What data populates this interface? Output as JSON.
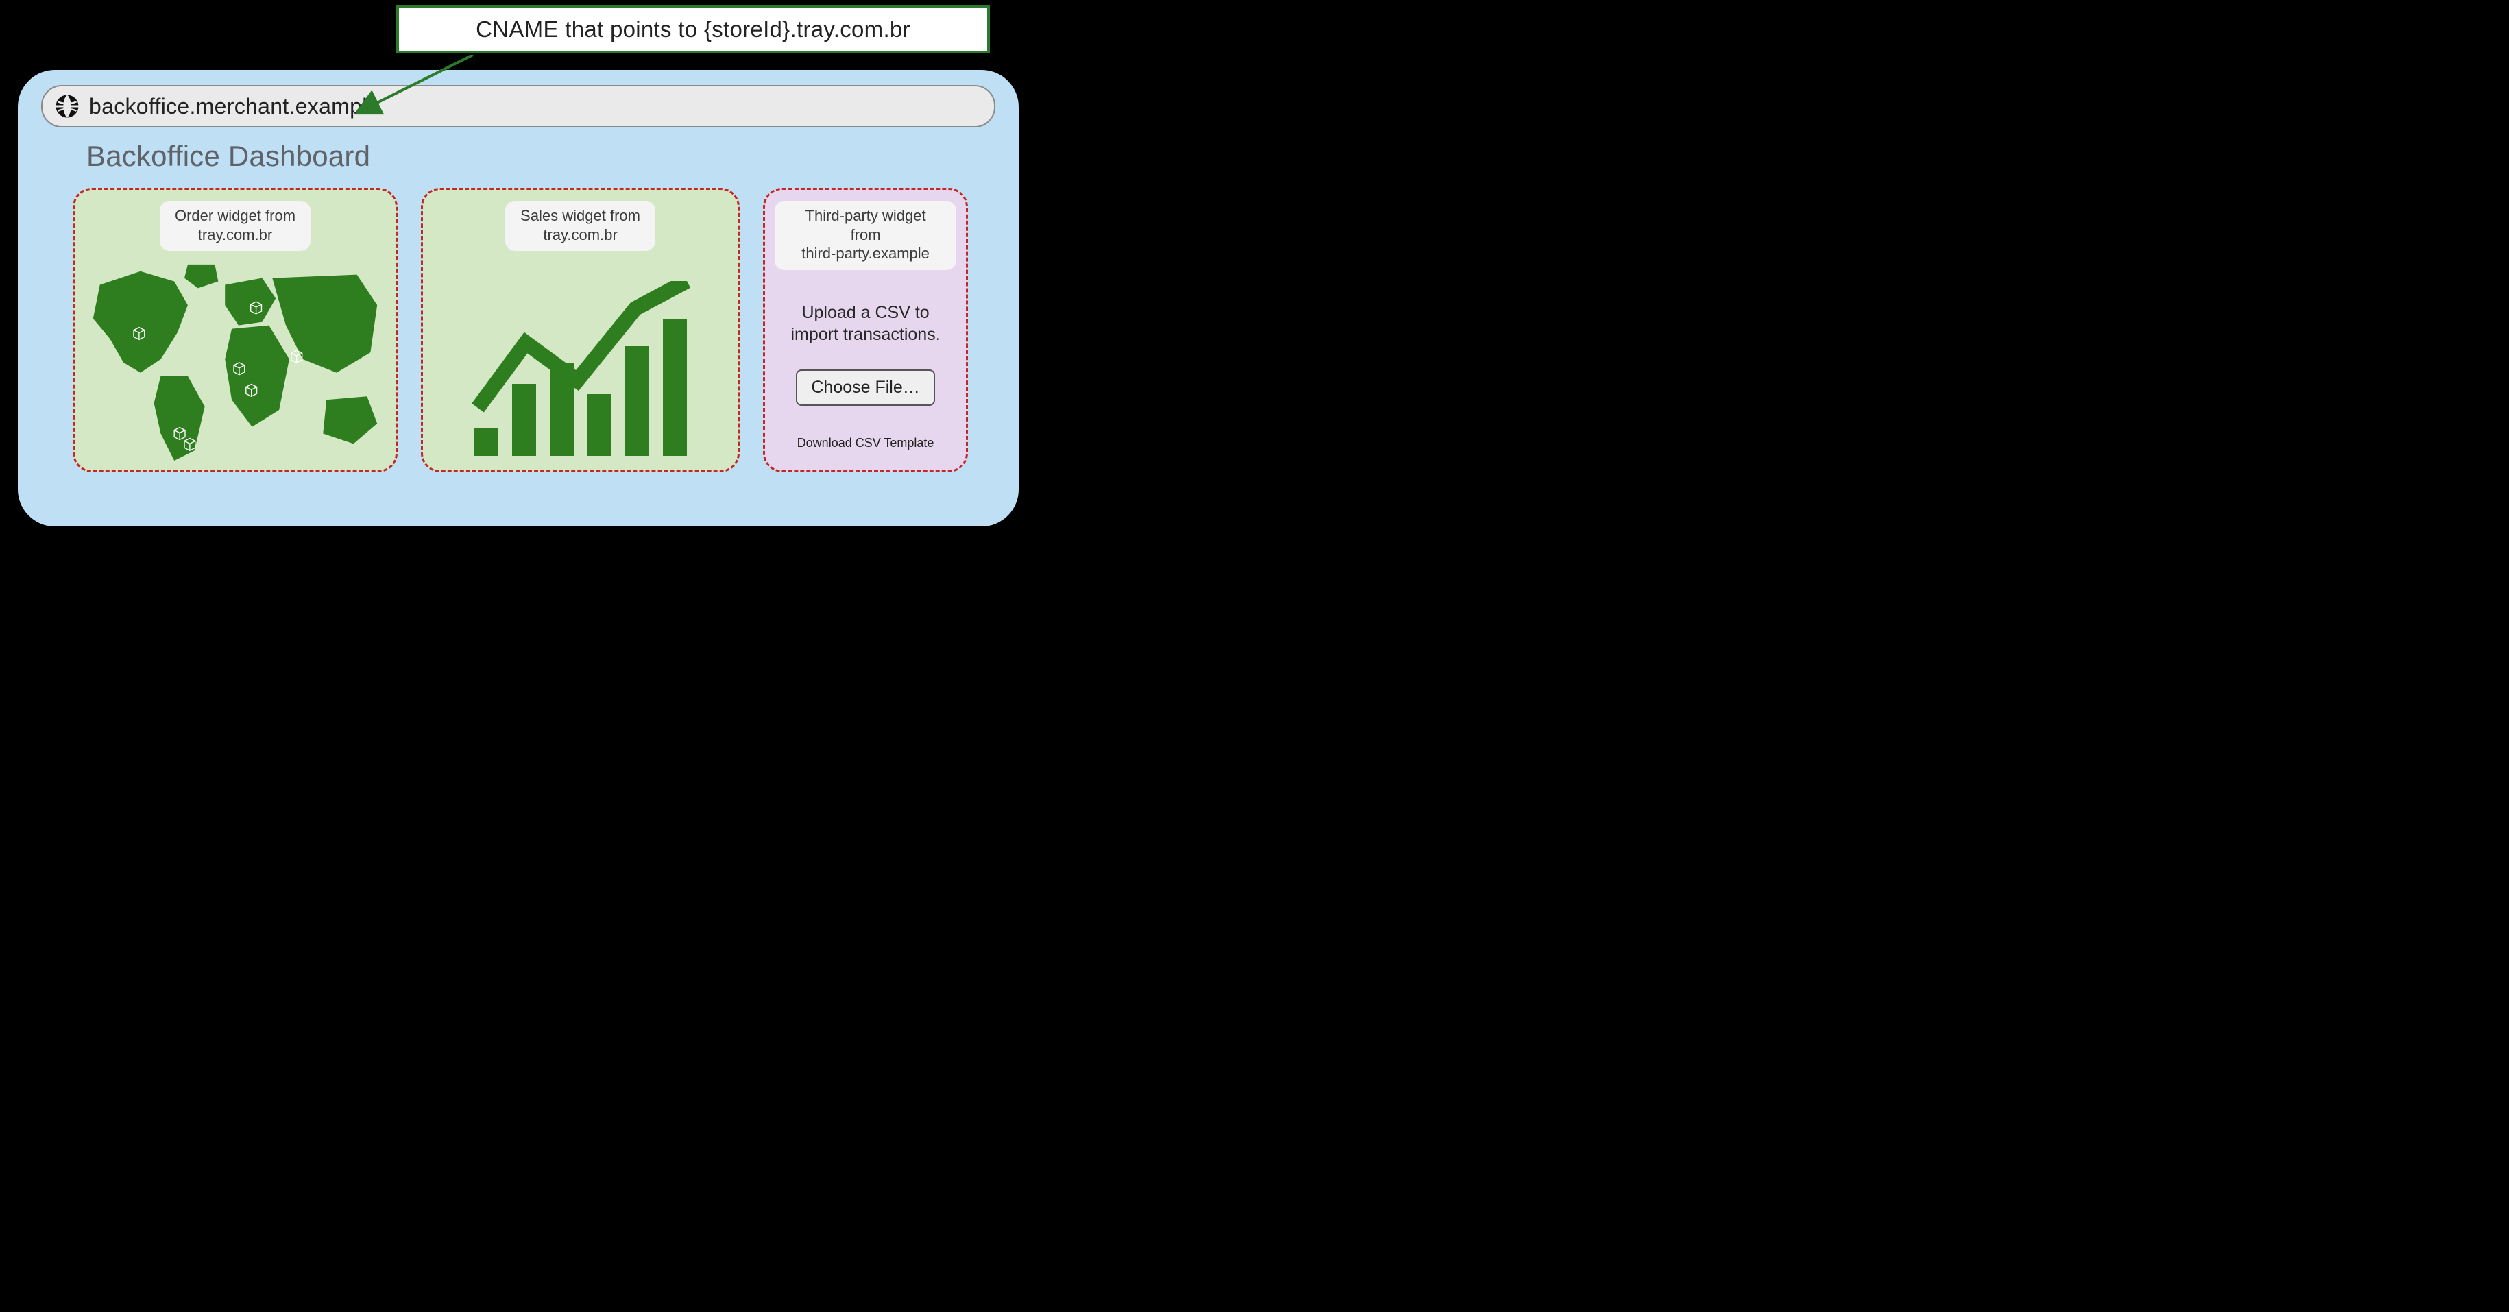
{
  "callout": {
    "text": "CNAME that points to {storeId}.tray.com.br"
  },
  "address_bar": {
    "url": "backoffice.merchant.example"
  },
  "page": {
    "title": "Backoffice Dashboard"
  },
  "widgets": {
    "order": {
      "label": "Order widget from\ntray.com.br"
    },
    "sales": {
      "label": "Sales widget from\ntray.com.br"
    },
    "third_party": {
      "label": "Third-party widget from\nthird-party.example",
      "upload_text": "Upload a CSV to\nimport transactions.",
      "choose_file_label": "Choose File…",
      "download_link_label": "Download CSV Template"
    }
  },
  "colors": {
    "window_bg": "#bfdff5",
    "widget_green": "#d4e8c6",
    "widget_purple": "#e7d7ee",
    "dash_red": "#c02929",
    "accent_green": "#2b7b2b"
  }
}
